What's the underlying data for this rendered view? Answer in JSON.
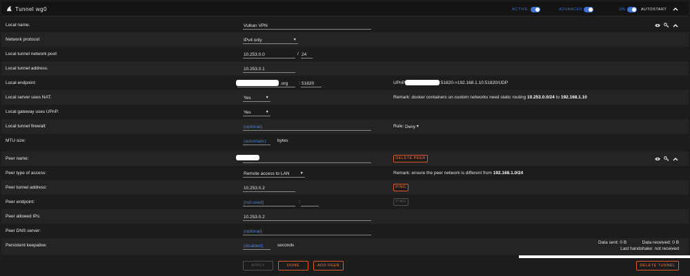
{
  "header": {
    "title": "Tunnel wg0",
    "active_label": "ACTIVE",
    "advanced_label": "ADVANCED",
    "on_label": "ON",
    "autostart_label": "AUTOSTART"
  },
  "local": {
    "name_label": "Local name:",
    "name_value": "Vulkan VPN",
    "protocol_label": "Network protocol:",
    "protocol_value": "IPv4 only",
    "pool_label": "Local tunnel network pool:",
    "pool_value": "10.253.0.0",
    "pool_mask_sep": "/",
    "pool_mask": "24",
    "address_label": "Local tunnel address:",
    "address_value": "10.253.0.1",
    "endpoint_label": "Local endpoint:",
    "endpoint_suffix": ".org",
    "endpoint_port_sep": ":",
    "endpoint_port": "51820",
    "upnp_prefix": "UPnP",
    "upnp_mapping": ":51820->192.168.1.10:51820/UDP",
    "nat_label": "Local server uses NAT:",
    "nat_value": "Yes",
    "nat_remark_prefix": "Remark: docker containers on custom networks need static routing",
    "nat_remark_net": "10.253.0.0/24",
    "nat_remark_to": "to",
    "nat_remark_host": "192.168.1.10",
    "gw_upnp_label": "Local gateway uses UPnP:",
    "gw_upnp_value": "Yes",
    "firewall_label": "Local tunnel firewall:",
    "firewall_placeholder": "(optional)",
    "rule_label": "Rule:",
    "rule_value": "Deny",
    "mtu_label": "MTU size:",
    "mtu_placeholder": "(automatic)",
    "mtu_unit": "bytes"
  },
  "peer": {
    "name_label": "Peer name:",
    "delete_peer": "DELETE PEER",
    "access_label": "Peer type of access:",
    "access_value": "Remote access to LAN",
    "access_remark_prefix": "Remark: ensure the peer network is different from",
    "access_remark_net": "192.168.1.0/24",
    "tunnel_addr_label": "Peer tunnel address:",
    "tunnel_addr_value": "10.253.0.2",
    "ping_label": "PING",
    "endpoint_label": "Peer endpoint:",
    "endpoint_placeholder": "(not used)",
    "endpoint_port_sep": ":",
    "ping_disabled_label": "PING",
    "allowed_label": "Peer allowed IPs:",
    "allowed_value": "10.253.0.2",
    "dns_label": "Peer DNS server:",
    "dns_placeholder": "(optional)",
    "keepalive_label": "Persistent keepalive:",
    "keepalive_placeholder": "(disabled)",
    "keepalive_unit": "seconds",
    "data_sent": "Data sent: 0 B",
    "data_received": "Data received: 0 B",
    "last_handshake": "Last handshake: not received"
  },
  "footer": {
    "apply": "APPLY",
    "done": "DONE",
    "add_peer": "ADD PEER",
    "delete_tunnel": "DELETE TUNNEL"
  },
  "icons": {
    "tunnel": "shark-fin-icon",
    "view": "eye-icon",
    "keys": "key-icon",
    "collapse": "chevron-up-icon"
  },
  "colors": {
    "accent_blue": "#3f74d6",
    "accent_orange": "#e05a2b",
    "placeholder_blue": "#4a82d6",
    "background": "#1c1c1c",
    "row_alt": "#242424"
  }
}
